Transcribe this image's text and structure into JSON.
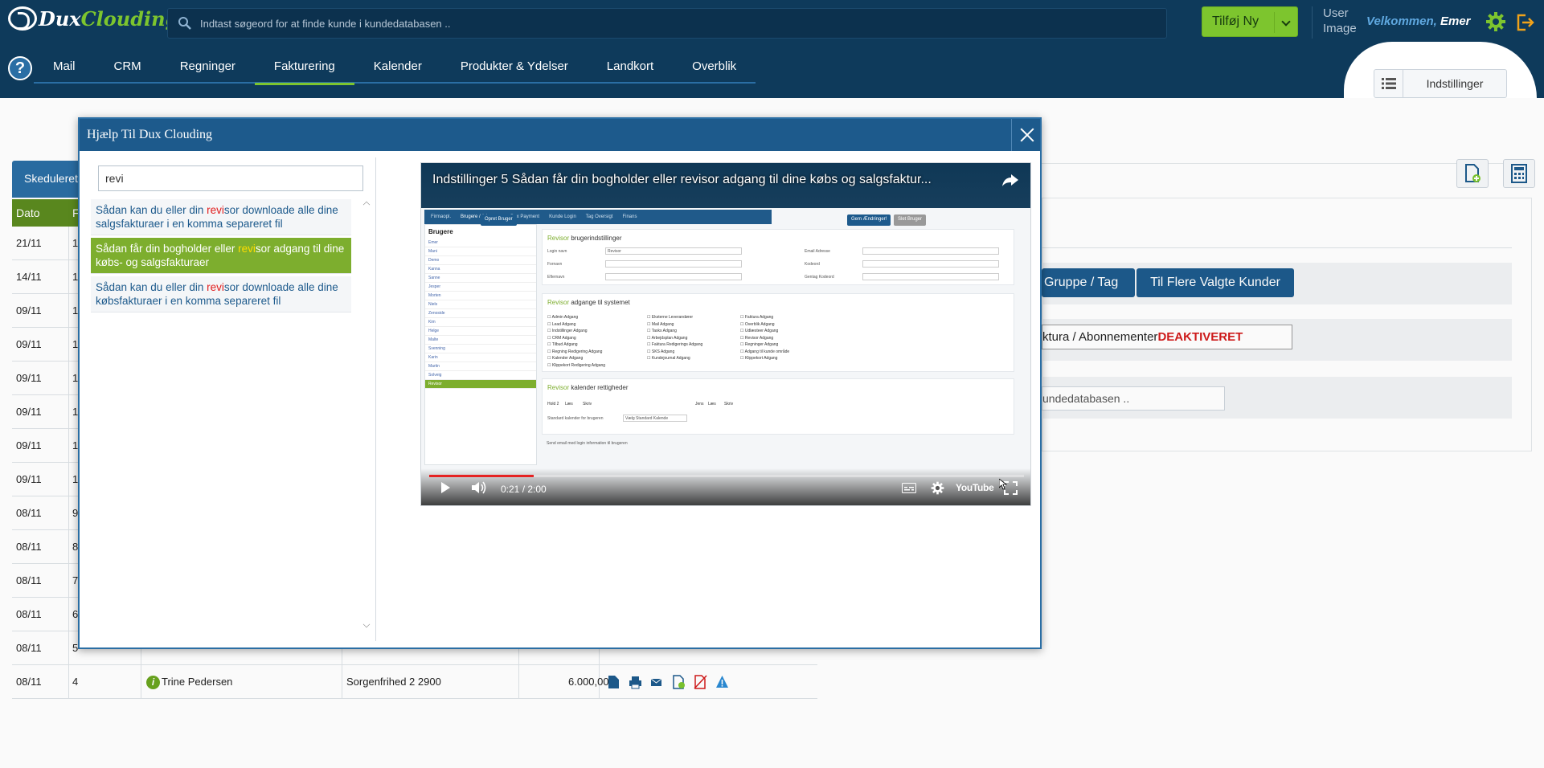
{
  "header": {
    "logo": {
      "part1": "Dux",
      "part2": "Clouding"
    },
    "search_placeholder": "Indtast søgeord for at finde kunde i kundedatabasen ..",
    "add_new_label": "Tilføj Ny",
    "user_image_alt": "User Image",
    "welcome_prefix": "Velkommen,",
    "user_name": "Emer"
  },
  "nav": {
    "items": [
      "Mail",
      "CRM",
      "Regninger",
      "Fakturering",
      "Kalender",
      "Produkter & Ydelser",
      "Landkort",
      "Overblik"
    ],
    "active": "Fakturering",
    "settings_label": "Indstillinger"
  },
  "background": {
    "tab_label": "Skeduleret",
    "table_headers": [
      "Dato",
      "F"
    ],
    "rows": [
      {
        "date": "21/11",
        "no": "1"
      },
      {
        "date": "14/11",
        "no": "1"
      },
      {
        "date": "09/11",
        "no": "1"
      },
      {
        "date": "09/11",
        "no": "1"
      },
      {
        "date": "09/11",
        "no": "1"
      },
      {
        "date": "09/11",
        "no": "1"
      },
      {
        "date": "09/11",
        "no": "1"
      },
      {
        "date": "09/11",
        "no": "1"
      },
      {
        "date": "08/11",
        "no": "9"
      },
      {
        "date": "08/11",
        "no": "8"
      },
      {
        "date": "08/11",
        "no": "7"
      },
      {
        "date": "08/11",
        "no": "6"
      },
      {
        "date": "08/11",
        "no": "5"
      },
      {
        "date": "08/11",
        "no": "4",
        "customer": "Trine Pedersen",
        "address": "Sorgenfrihed 2 2900",
        "amount": "6.000,00"
      }
    ],
    "group_button": "Gruppe / Tag",
    "multi_button": "Til Flere Valgte Kunder",
    "faktura_label": "ktura / Abonnementer",
    "faktura_status": "DEAKTIVERET",
    "kunde_placeholder": "undedatabasen .."
  },
  "modal": {
    "title": "Hjælp Til Dux Clouding",
    "search_value": "revi",
    "results": [
      {
        "before": "Sådan kan du eller din ",
        "hl": "revi",
        "after": "sor downloade alle dine salgsfakturaer i en komma separeret fil",
        "active": false
      },
      {
        "before": "Sådan får din bogholder eller ",
        "hl": "revi",
        "after": "sor adgang til dine købs- og salgsfakturaer",
        "active": true
      },
      {
        "before": "Sådan kan du eller din ",
        "hl": "revi",
        "after": "sor downloade alle dine købsfakturaer i en komma separeret fil",
        "active": false
      }
    ],
    "video": {
      "title": "Indstillinger 5 Sådan får din bogholder eller revisor adgang til dine købs og salgsfaktur...",
      "time": "0:21 / 2:00",
      "progress": 0.175,
      "brand": "YouTube",
      "tabs": [
        "Firmaopl.",
        "Brugere / Adgange",
        "Dux Payment",
        "Kunde Login",
        "Tag Oversigt",
        "Finans"
      ],
      "sidebar_title": "Brugere",
      "users": [
        "Emer",
        "Mani",
        "Demo",
        "Kanna",
        "Sanne",
        "Jesper",
        "Morten",
        "Niels",
        "Zenoside",
        "Kim",
        "Helge",
        "Malte",
        "Svenning",
        "Karin",
        "Martin",
        "Solveig",
        "Revisor"
      ],
      "create_user": "Opret Bruger",
      "save_changes": "Gem Ændringer!",
      "delete_user": "Slet Bruger",
      "settings_heading": "brugerindstillinger",
      "access_heading": "adgange til systemet",
      "calendar_heading": "kalender rettigheder",
      "revisor_word": "Revisor",
      "fields": [
        "Login navn",
        "Fornavn",
        "Efternavn",
        "Email Adresse",
        "Kodeord",
        "Gentag Kodeord"
      ],
      "login_value": "Revisor",
      "access_col1": [
        "Admin Adgang",
        "Lead Adgang",
        "Indstillinger Adgang",
        "CRM Adgang",
        "Tilbud Adgang",
        "Regning Redigering Adgang",
        "Kalender Adgang",
        "Klippekort Redigering Adgang"
      ],
      "access_col2": [
        "Eksterne Leverandører",
        "Mail Adgang",
        "Tasks Adgang",
        "Arbejdsplan Adgang",
        "Faktura Redigerings Adgang",
        "SKS Adgang",
        "Kundejournal Adgang"
      ],
      "access_col3": [
        "Faktura Adgang",
        "Overblik Adgang",
        "Udlæsteer Adgang",
        "Revisor Adgang",
        "Regninger Adgang",
        "Adgang til kunde område",
        "Klippekort Adgang"
      ],
      "cal_row": [
        "Hold 2",
        "Læs",
        "Skriv",
        "Jens",
        "Læs",
        "Skriv"
      ],
      "cal_std": "Standard kalender for brugeren",
      "cal_std_value": "Vælg Standard Kalende",
      "send_info": "Send email med login information til brugeren"
    }
  },
  "colors": {
    "nav_bg": "#0e3a5b",
    "accent_green": "#7dc52e",
    "modal_header": "#1d5a8c",
    "highlight_red": "#e11d1d"
  }
}
